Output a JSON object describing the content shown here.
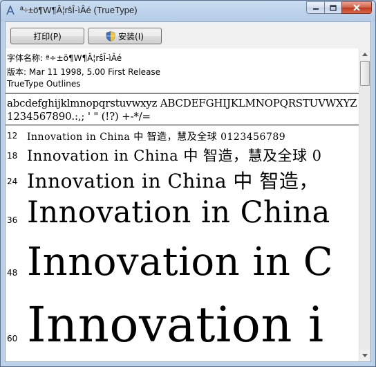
{
  "window": {
    "title": "ª÷±ö¶W¶Â¦rŝÎ-ìÂé (TrueType)"
  },
  "toolbar": {
    "print_label": "打印(P)",
    "install_label": "安装(I)"
  },
  "info": {
    "font_name_line": "字体名称: ª÷±ö¶W¶Â¦rŝÎ-ìÂé",
    "version_line": "版本: Mar 11 1998, 5.00 First Release",
    "outline_line": "TrueType Outlines"
  },
  "charset": {
    "line1": "abcdefghijklmnopqrstuvwxyz ABCDEFGHIJKLMNOPQRSTUVWXYZ",
    "line2": "1234567890.:,; ' \" (!?) +-*/="
  },
  "samples": [
    {
      "size": "12",
      "text": "Innovation in China 中 智造，慧及全球 0123456789"
    },
    {
      "size": "18",
      "text": "Innovation in China 中 智造，慧及全球 0"
    },
    {
      "size": "24",
      "text": "Innovation in China 中 智造，"
    },
    {
      "size": "36",
      "text": "Innovation in China"
    },
    {
      "size": "48",
      "text": "Innovation in C"
    },
    {
      "size": "60",
      "text": "Innovation i"
    }
  ],
  "colors": {
    "titlebar": "#b4cbe6",
    "close_button": "#c2371c",
    "content_bg": "#ffffff"
  },
  "icons": {
    "app": "font-file-icon",
    "shield": "uac-shield-icon"
  }
}
